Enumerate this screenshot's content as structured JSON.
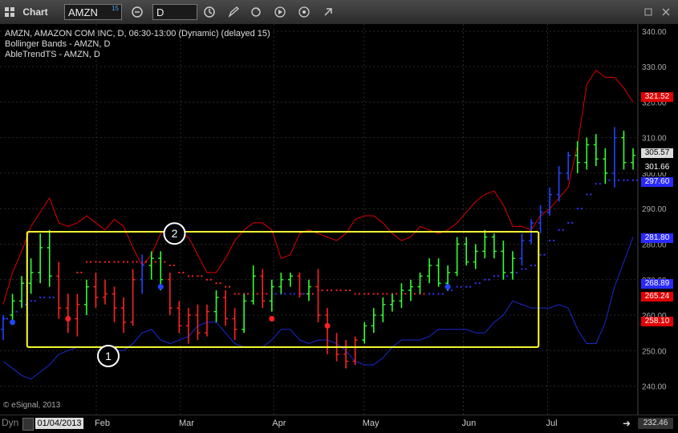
{
  "toolbar": {
    "app_icon": "grid-icon",
    "title": "Chart",
    "symbol": "AMZN",
    "symbol_badge": "15",
    "interval": "D"
  },
  "legend": [
    "AMZN, AMAZON COM INC, D, 06:30-13:00 (Dynamic) (delayed 15)",
    "Bollinger Bands - AMZN, D",
    "AbleTrendTS - AMZN, D"
  ],
  "copyright": "© eSignal, 2013",
  "bottom": {
    "dyn_label": "Dyn",
    "date_label": "01/04/2013",
    "corner_value": "232.46"
  },
  "annotations": [
    {
      "label": "1",
      "x": "2013-02-05",
      "y": 248.5
    },
    {
      "label": "2",
      "x": "2013-02-27",
      "y": 283
    }
  ],
  "highlight_box": {
    "x_from": "2013-01-09",
    "x_to": "2013-06-28",
    "y_from": 251,
    "y_to": 283.5,
    "color": "#ffff33"
  },
  "colors": {
    "up": "#33ff33",
    "down": "#ff2222",
    "neutral": "#2244ff",
    "upper_band": "#e00000",
    "lower_band": "#1a2ad0",
    "middle_band": "#000000",
    "stop_long": "#3333ff",
    "stop_short": "#ff2222",
    "box": "#ffff33",
    "grid": "#2a2a2a"
  },
  "chart_data": {
    "type": "candlestick",
    "y_axis": {
      "min": 232,
      "max": 342,
      "ticks": [
        "340.00",
        "330.00",
        "320.00",
        "310.00",
        "300.00",
        "290.00",
        "280.00",
        "270.00",
        "260.00",
        "250.00",
        "240.00"
      ],
      "tick_values": [
        340,
        330,
        320,
        310,
        300,
        290,
        280,
        270,
        260,
        250,
        240
      ]
    },
    "x_axis": {
      "labels": [
        "Feb",
        "Mar",
        "Apr",
        "May",
        "Jun",
        "Jul"
      ],
      "label_dates": [
        "2013-02-01",
        "2013-03-01",
        "2013-04-01",
        "2013-05-01",
        "2013-06-03",
        "2013-07-01"
      ],
      "start": "2012-12-31",
      "end": "2013-07-31"
    },
    "price_tags": [
      {
        "value": 321.52,
        "text": "321.52",
        "bg": "#e00000",
        "fg": "#ffffff"
      },
      {
        "value": 305.57,
        "text": "305.57",
        "bg": "#dddddd",
        "fg": "#000000"
      },
      {
        "value": 301.66,
        "text": "301.66",
        "bg": "#000000",
        "fg": "#ffffff"
      },
      {
        "value": 297.6,
        "text": "297.60",
        "bg": "#2a2aff",
        "fg": "#ffffff"
      },
      {
        "value": 281.8,
        "text": "281.80",
        "bg": "#2a2aff",
        "fg": "#ffffff"
      },
      {
        "value": 268.89,
        "text": "268.89",
        "bg": "#2a2aff",
        "fg": "#ffffff"
      },
      {
        "value": 265.24,
        "text": "265.24",
        "bg": "#e00000",
        "fg": "#ffffff"
      },
      {
        "value": 258.1,
        "text": "258.10",
        "bg": "#e00000",
        "fg": "#ffffff"
      }
    ],
    "series": [
      {
        "type": "band",
        "role": "upper",
        "color": "#e00000",
        "values": [
          263,
          272,
          278,
          285,
          289,
          293,
          286,
          285,
          286,
          288,
          286,
          284,
          287,
          285,
          279,
          274,
          277,
          283,
          285,
          283,
          282,
          277,
          272,
          272,
          276,
          281,
          284,
          286,
          286,
          284,
          276,
          277,
          283,
          284,
          283,
          282,
          281,
          283,
          287,
          288,
          288,
          286,
          283,
          281,
          282,
          285,
          284,
          283,
          284,
          286,
          289,
          292,
          294,
          295,
          291,
          285,
          285,
          284,
          288,
          290,
          293,
          296,
          308,
          325,
          329,
          327,
          327,
          324,
          320
        ]
      },
      {
        "type": "band",
        "role": "middle",
        "color": "#000000",
        "values": [
          256,
          258,
          262,
          266,
          269,
          271,
          268,
          267,
          268,
          269,
          268,
          267,
          268,
          267,
          266,
          265,
          266,
          267,
          268,
          268,
          268,
          267,
          265,
          265,
          265,
          266,
          268,
          269,
          269,
          268,
          266,
          266,
          267,
          268,
          268,
          267,
          266,
          266,
          267,
          268,
          268,
          268,
          268,
          268,
          268,
          269,
          270,
          271,
          272,
          272,
          272,
          273,
          274,
          276,
          276,
          276,
          276,
          276,
          277,
          280,
          283,
          287,
          292,
          297,
          300,
          301,
          301,
          301,
          301
        ]
      },
      {
        "type": "band",
        "role": "lower",
        "color": "#1a2ad0",
        "values": [
          247,
          245,
          243,
          242,
          244,
          246,
          249,
          250,
          251,
          251,
          251,
          251,
          250,
          250,
          252,
          255,
          256,
          253,
          252,
          253,
          254,
          257,
          258,
          258,
          255,
          252,
          251,
          251,
          251,
          253,
          256,
          256,
          253,
          252,
          253,
          253,
          252,
          250,
          247,
          246,
          246,
          248,
          251,
          253,
          253,
          253,
          254,
          256,
          256,
          256,
          256,
          255,
          255,
          258,
          260,
          264,
          263,
          262,
          262,
          262,
          263,
          262,
          256,
          252,
          252,
          258,
          268,
          275,
          282
        ]
      },
      {
        "type": "stop",
        "role": "long",
        "color": "#3333ff",
        "points": [
          [
            0,
            259
          ],
          [
            1,
            261
          ],
          [
            2,
            263
          ],
          [
            3,
            264
          ],
          [
            4,
            265
          ],
          [
            5,
            265
          ],
          [
            29,
            266
          ],
          [
            30,
            266
          ],
          [
            31,
            266
          ],
          [
            32,
            266
          ],
          [
            46,
            266
          ],
          [
            47,
            266
          ],
          [
            48,
            267
          ],
          [
            49,
            268
          ],
          [
            50,
            268
          ],
          [
            51,
            269
          ],
          [
            52,
            270
          ],
          [
            53,
            271
          ],
          [
            54,
            271
          ],
          [
            55,
            272
          ],
          [
            56,
            273
          ],
          [
            57,
            274
          ],
          [
            58,
            277
          ],
          [
            59,
            281
          ],
          [
            60,
            284
          ],
          [
            61,
            286
          ],
          [
            62,
            290
          ],
          [
            63,
            294
          ],
          [
            64,
            297
          ],
          [
            65,
            298
          ],
          [
            66,
            298
          ],
          [
            67,
            298
          ],
          [
            68,
            298
          ]
        ]
      },
      {
        "type": "stop",
        "role": "short",
        "color": "#ff2222",
        "points": [
          [
            8,
            272
          ],
          [
            9,
            275
          ],
          [
            10,
            275
          ],
          [
            11,
            275
          ],
          [
            12,
            275
          ],
          [
            13,
            275
          ],
          [
            14,
            275
          ],
          [
            15,
            275
          ],
          [
            16,
            275
          ],
          [
            17,
            275
          ],
          [
            18,
            274
          ],
          [
            19,
            272
          ],
          [
            20,
            271
          ],
          [
            21,
            271
          ],
          [
            22,
            270
          ],
          [
            23,
            269
          ],
          [
            24,
            268
          ],
          [
            25,
            266
          ],
          [
            26,
            266
          ],
          [
            27,
            266
          ],
          [
            28,
            266
          ],
          [
            33,
            266
          ],
          [
            34,
            267
          ],
          [
            35,
            267
          ],
          [
            36,
            267
          ],
          [
            37,
            267
          ],
          [
            38,
            266
          ],
          [
            39,
            266
          ],
          [
            40,
            266
          ],
          [
            41,
            266
          ],
          [
            42,
            266
          ],
          [
            43,
            266
          ],
          [
            44,
            266
          ],
          [
            45,
            266
          ]
        ]
      },
      {
        "type": "candles",
        "values": [
          [
            256,
            260,
            253,
            259,
            "n"
          ],
          [
            260,
            266,
            258,
            264,
            "u"
          ],
          [
            264,
            271,
            262,
            269,
            "u"
          ],
          [
            269,
            276,
            266,
            272,
            "u"
          ],
          [
            272,
            283,
            269,
            279,
            "u"
          ],
          [
            279,
            284,
            268,
            271,
            "u"
          ],
          [
            271,
            275,
            259,
            262,
            "d"
          ],
          [
            262,
            266,
            255,
            259,
            "d"
          ],
          [
            259,
            266,
            254,
            263,
            "d"
          ],
          [
            263,
            270,
            260,
            268,
            "u"
          ],
          [
            268,
            272,
            262,
            265,
            "d"
          ],
          [
            265,
            270,
            263,
            266,
            "d"
          ],
          [
            266,
            268,
            258,
            262,
            "d"
          ],
          [
            262,
            265,
            255,
            258,
            "d"
          ],
          [
            258,
            273,
            257,
            270,
            "d"
          ],
          [
            270,
            277,
            266,
            274,
            "n"
          ],
          [
            274,
            278,
            270,
            276,
            "u"
          ],
          [
            276,
            278,
            267,
            270,
            "u"
          ],
          [
            270,
            272,
            260,
            262,
            "d"
          ],
          [
            262,
            264,
            255,
            257,
            "d"
          ],
          [
            257,
            262,
            252,
            260,
            "d"
          ],
          [
            260,
            263,
            253,
            255,
            "d"
          ],
          [
            255,
            263,
            254,
            261,
            "d"
          ],
          [
            261,
            267,
            258,
            265,
            "u"
          ],
          [
            265,
            267,
            257,
            259,
            "d"
          ],
          [
            259,
            262,
            253,
            256,
            "d"
          ],
          [
            256,
            266,
            255,
            264,
            "u"
          ],
          [
            264,
            274,
            263,
            271,
            "u"
          ],
          [
            271,
            273,
            262,
            264,
            "d"
          ],
          [
            264,
            270,
            261,
            268,
            "u"
          ],
          [
            268,
            272,
            266,
            270,
            "u"
          ],
          [
            270,
            272,
            268,
            271,
            "u"
          ],
          [
            271,
            272,
            265,
            266,
            "d"
          ],
          [
            266,
            270,
            264,
            268,
            "u"
          ],
          [
            268,
            273,
            258,
            260,
            "d"
          ],
          [
            260,
            262,
            249,
            251,
            "d"
          ],
          [
            251,
            255,
            247,
            249,
            "d"
          ],
          [
            249,
            253,
            245,
            247,
            "d"
          ],
          [
            247,
            254,
            246,
            253,
            "d"
          ],
          [
            253,
            258,
            252,
            257,
            "u"
          ],
          [
            257,
            262,
            255,
            260,
            "u"
          ],
          [
            260,
            265,
            258,
            263,
            "u"
          ],
          [
            263,
            266,
            261,
            264,
            "u"
          ],
          [
            264,
            269,
            262,
            267,
            "u"
          ],
          [
            267,
            270,
            264,
            268,
            "u"
          ],
          [
            268,
            272,
            266,
            271,
            "u"
          ],
          [
            271,
            276,
            269,
            274,
            "u"
          ],
          [
            274,
            276,
            268,
            269,
            "u"
          ],
          [
            269,
            274,
            267,
            272,
            "u"
          ],
          [
            272,
            282,
            271,
            280,
            "u"
          ],
          [
            280,
            282,
            274,
            275,
            "u"
          ],
          [
            275,
            280,
            273,
            278,
            "u"
          ],
          [
            278,
            284,
            276,
            282,
            "u"
          ],
          [
            282,
            283,
            276,
            278,
            "u"
          ],
          [
            278,
            281,
            270,
            272,
            "u"
          ],
          [
            272,
            278,
            270,
            276,
            "u"
          ],
          [
            276,
            283,
            274,
            281,
            "n"
          ],
          [
            281,
            287,
            280,
            286,
            "n"
          ],
          [
            286,
            291,
            283,
            289,
            "n"
          ],
          [
            289,
            296,
            288,
            294,
            "n"
          ],
          [
            294,
            302,
            292,
            300,
            "n"
          ],
          [
            300,
            306,
            298,
            305,
            "n"
          ],
          [
            305,
            309,
            300,
            303,
            "u"
          ],
          [
            303,
            310,
            301,
            308,
            "u"
          ],
          [
            308,
            311,
            302,
            304,
            "u"
          ],
          [
            304,
            307,
            297,
            300,
            "u"
          ],
          [
            300,
            313,
            296,
            310,
            "n"
          ],
          [
            310,
            312,
            301,
            303,
            "u"
          ],
          [
            303,
            307,
            301,
            305,
            "u"
          ]
        ]
      },
      {
        "type": "markers",
        "items": [
          {
            "index": 7,
            "value": 259,
            "color": "#ff2222"
          },
          {
            "index": 29,
            "value": 259,
            "color": "#ff2222"
          },
          {
            "index": 17,
            "value": 268,
            "color": "#2244ff"
          },
          {
            "index": 35,
            "value": 257,
            "color": "#ff2222"
          },
          {
            "index": 48,
            "value": 268,
            "color": "#2244ff"
          },
          {
            "index": 1,
            "value": 258,
            "color": "#2244ff"
          }
        ]
      }
    ]
  }
}
